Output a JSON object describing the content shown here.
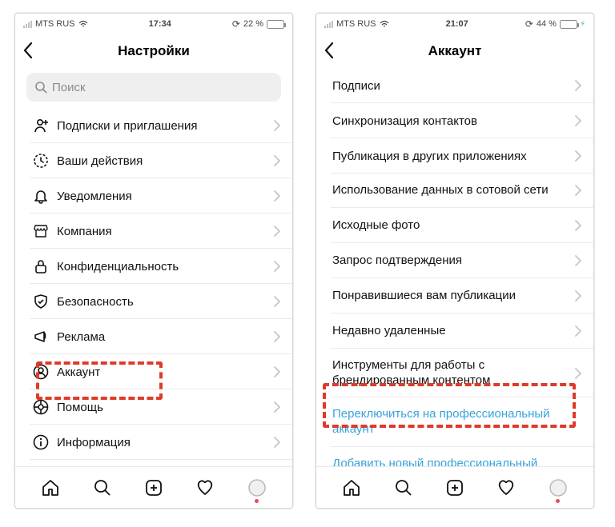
{
  "left": {
    "status": {
      "carrier": "MTS RUS",
      "time": "17:34",
      "battery_pct": "22 %",
      "battery_fill": 22,
      "charging": false
    },
    "title": "Настройки",
    "search_placeholder": "Поиск",
    "rows": [
      {
        "icon": "follow",
        "label": "Подписки и приглашения"
      },
      {
        "icon": "activity",
        "label": "Ваши действия"
      },
      {
        "icon": "bell",
        "label": "Уведомления"
      },
      {
        "icon": "shop",
        "label": "Компания"
      },
      {
        "icon": "lock",
        "label": "Конфиденциальность"
      },
      {
        "icon": "shield",
        "label": "Безопасность"
      },
      {
        "icon": "megaphone",
        "label": "Реклама"
      },
      {
        "icon": "user",
        "label": "Аккаунт"
      },
      {
        "icon": "help",
        "label": "Помощь"
      },
      {
        "icon": "info",
        "label": "Информация"
      }
    ]
  },
  "right": {
    "status": {
      "carrier": "MTS RUS",
      "time": "21:07",
      "battery_pct": "44 %",
      "battery_fill": 44,
      "charging": true
    },
    "title": "Аккаунт",
    "rows": [
      {
        "label": "Подписи"
      },
      {
        "label": "Синхронизация контактов"
      },
      {
        "label": "Публикация в других приложениях"
      },
      {
        "label": "Использование данных в сотовой сети"
      },
      {
        "label": "Исходные фото"
      },
      {
        "label": "Запрос подтверждения"
      },
      {
        "label": "Понравившиеся вам публикации"
      },
      {
        "label": "Недавно удаленные"
      },
      {
        "label": "Инструменты для работы с брендированным контентом"
      },
      {
        "label": "Переключиться на профессиональный аккаунт",
        "link": true,
        "nochev": true
      },
      {
        "label": "Добавить новый профессиональный аккаунт",
        "link": true,
        "nochev": true
      }
    ]
  }
}
